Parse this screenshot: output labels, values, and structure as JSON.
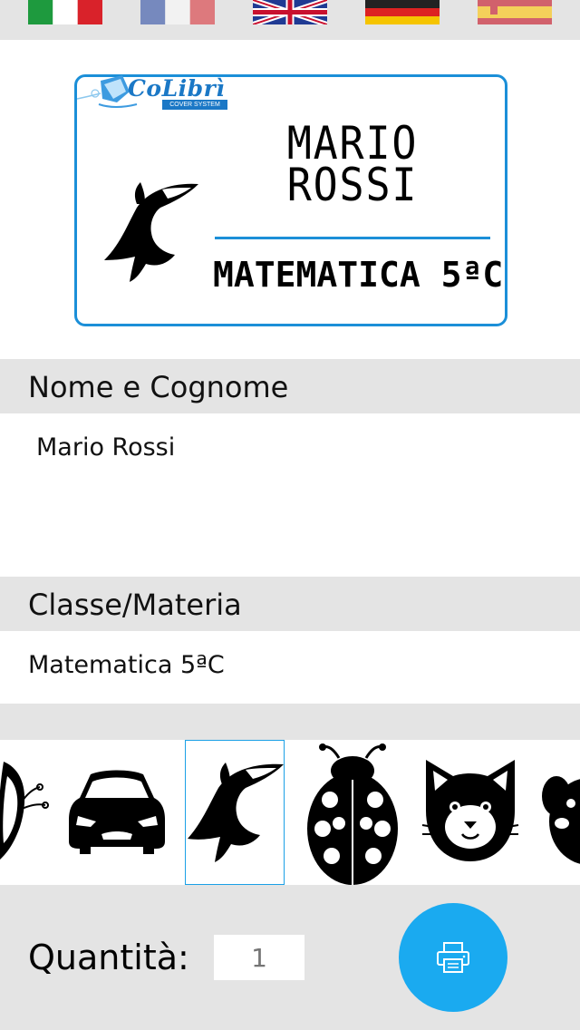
{
  "languages": [
    {
      "code": "it",
      "icon": "italy-flag-icon"
    },
    {
      "code": "fr",
      "icon": "france-flag-icon"
    },
    {
      "code": "en",
      "icon": "uk-flag-icon"
    },
    {
      "code": "de",
      "icon": "germany-flag-icon"
    },
    {
      "code": "es",
      "icon": "spain-flag-icon"
    }
  ],
  "preview": {
    "logo_text": "CoLibrì",
    "logo_subtitle": "COVER SYSTEM",
    "name_line1": "MARIO",
    "name_line2": "ROSSI",
    "class_text": "MATEMATICA 5ªC",
    "icon": "shark-icon",
    "border_color": "#1b8fd8"
  },
  "name_section": {
    "header": "Nome e Cognome",
    "value": "Mario Rossi"
  },
  "class_section": {
    "header": "Classe/Materia",
    "value": "Matematica 5ªC"
  },
  "icon_picker": {
    "items": [
      "butterfly-icon",
      "car-icon",
      "shark-icon",
      "ladybug-icon",
      "cat-icon",
      "dog-icon"
    ],
    "selected": "shark-icon"
  },
  "quantity": {
    "label": "Quantità:",
    "placeholder": "1"
  },
  "print_button": {
    "icon": "printer-icon",
    "color": "#1aaaf0"
  }
}
